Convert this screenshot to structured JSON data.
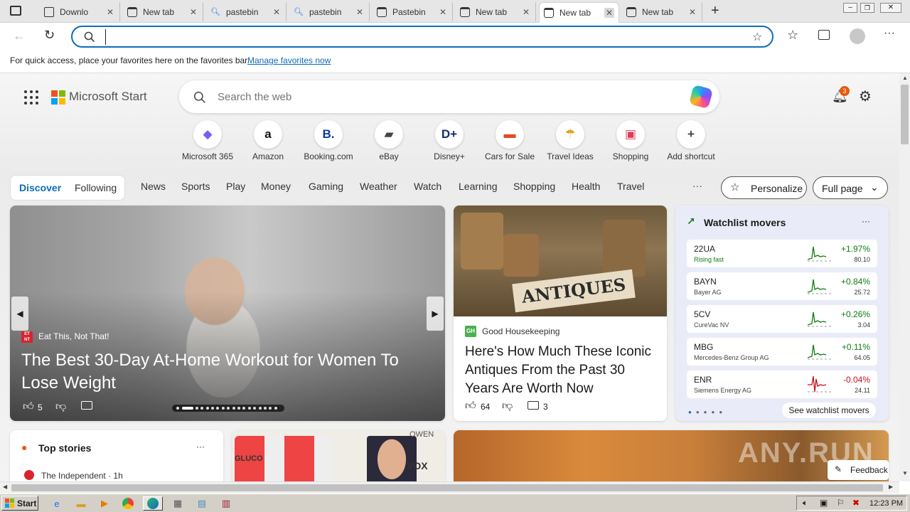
{
  "tabs": [
    {
      "title": "Downlo",
      "icon": "page-icon"
    },
    {
      "title": "New tab",
      "icon": "newtab-icon"
    },
    {
      "title": "pastebin",
      "icon": "search-icon"
    },
    {
      "title": "pastebin",
      "icon": "search-icon"
    },
    {
      "title": "Pastebin",
      "icon": "pastebin-icon"
    },
    {
      "title": "New tab",
      "icon": "newtab-icon"
    },
    {
      "title": "New tab",
      "icon": "newtab-icon"
    },
    {
      "title": "New tab",
      "icon": "newtab-icon"
    }
  ],
  "address": {
    "value": "",
    "placeholder": ""
  },
  "favbar": {
    "text": "For quick access, place your favorites here on the favorites bar.",
    "link": "Manage favorites now"
  },
  "msstart": {
    "logo_text": "Microsoft Start",
    "search_placeholder": "Search the web",
    "notif_count": "3"
  },
  "shortcuts": [
    {
      "label": "Microsoft 365",
      "glyph": "◆",
      "color": "#7b5cf0"
    },
    {
      "label": "Amazon",
      "glyph": "a",
      "color": "#111111"
    },
    {
      "label": "Booking.com",
      "glyph": "B.",
      "color": "#0a3a99"
    },
    {
      "label": "eBay",
      "glyph": "▰",
      "color": "#444444"
    },
    {
      "label": "Disney+",
      "glyph": "D+",
      "color": "#1a2a6c"
    },
    {
      "label": "Cars for Sale",
      "glyph": "▬",
      "color": "#e24a2a"
    },
    {
      "label": "Travel Ideas",
      "glyph": "☂",
      "color": "#e8a020"
    },
    {
      "label": "Shopping",
      "glyph": "▣",
      "color": "#e23a5a"
    },
    {
      "label": "Add shortcut",
      "glyph": "+",
      "color": "#444444"
    }
  ],
  "feednav": {
    "tab_discover": "Discover",
    "tab_following": "Following",
    "items": [
      "News",
      "Sports",
      "Play",
      "Money",
      "Gaming",
      "Weather",
      "Watch",
      "Learning",
      "Shopping",
      "Health",
      "Travel"
    ],
    "more": "···",
    "personalize": "Personalize",
    "layout": "Full page"
  },
  "hero": {
    "source": "Eat This, Not That!",
    "source_badge": "ET NT",
    "title": "The Best 30-Day At-Home Workout for Women To Lose Weight",
    "likes": "5"
  },
  "article2": {
    "source": "Good Housekeeping",
    "source_badge": "GH",
    "title": "Here's How Much These Iconic Antiques From the Past 30 Years Are Worth Now",
    "image_sign": "ANTIQUES",
    "likes": "64",
    "comments": "3"
  },
  "watchlist": {
    "title": "Watchlist movers",
    "more": "···",
    "footer": "See watchlist movers",
    "stocks": [
      {
        "symbol": "22UA",
        "name": "Rising fast",
        "change": "+1.97%",
        "price": "80.10",
        "up": true
      },
      {
        "symbol": "BAYN",
        "name": "Bayer AG",
        "change": "+0.84%",
        "price": "25.72",
        "up": true
      },
      {
        "symbol": "5CV",
        "name": "CureVac NV",
        "change": "+0.26%",
        "price": "3.04",
        "up": true
      },
      {
        "symbol": "MBG",
        "name": "Mercedes-Benz Group AG",
        "change": "+0.11%",
        "price": "64.05",
        "up": true
      },
      {
        "symbol": "ENR",
        "name": "Siemens Energy AG",
        "change": "-0.04%",
        "price": "24.11",
        "up": false
      }
    ]
  },
  "topstories": {
    "title": "Top stories",
    "more": "···",
    "first_source": "The Independent · 1h"
  },
  "ad": {
    "brand_text": "GLUCO",
    "corner_text": "OWEN",
    "vox": "VOX"
  },
  "feedback": "Feedback",
  "watermark": "ANY.RUN",
  "taskbar": {
    "start": "Start",
    "clock": "12:23 PM"
  },
  "colors": {
    "accent": "#0f6cbd",
    "up": "#107c10",
    "down": "#c50f1f"
  }
}
